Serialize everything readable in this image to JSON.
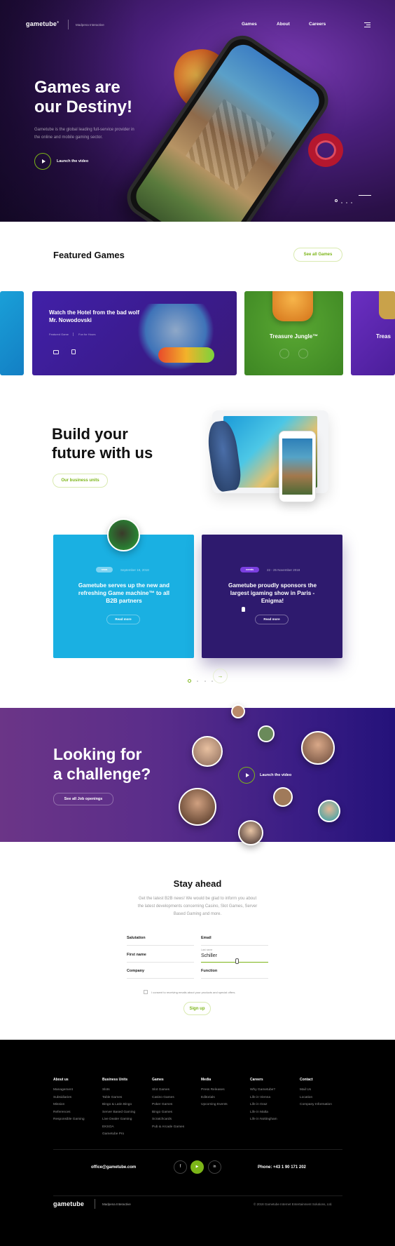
{
  "header": {
    "logo": "gametube",
    "logo_mark": "®",
    "logo_sub": "Madpena Interactive",
    "nav": [
      "Games",
      "About",
      "Careers"
    ],
    "menu_icon": "hamburger-icon"
  },
  "hero": {
    "title_line1": "Games are",
    "title_line2": "our Destiny!",
    "text": "Gametube is the global leading full-service provider in the online and mobile gaming sector.",
    "video_label": "Launch the video"
  },
  "featured": {
    "title": "Featured Games",
    "see_all": "See all Games",
    "card_main": {
      "title": "Watch the Hotel from the bad wolf Mr. Nowodovski",
      "meta1": "Featured Game",
      "meta2": "Fun for Hours"
    },
    "card_green": {
      "title": "Treasure Jungle™"
    },
    "card_purple": {
      "title": "Treas"
    }
  },
  "build": {
    "title_line1": "Build your",
    "title_line2": "future with us",
    "button": "Our business units"
  },
  "news": [
    {
      "tag": "news",
      "date": "September 18, 2018",
      "title": "Gametube serves up the new and refreshing Game machine™ to all B2B partners",
      "read": "Read more",
      "color": "#1ab0e2",
      "tag_color": "#7fd4f2"
    },
    {
      "tag": "events",
      "date": "22 - 25 November 2018",
      "title": "Gametube proudly sponsors the largest igaming show in Paris - Enigma!",
      "read": "Read more",
      "color": "#2e1a6e",
      "tag_color": "#7b3fe0"
    }
  ],
  "challenge": {
    "title_line1": "Looking for",
    "title_line2": "a challenge?",
    "button": "See all Job openings",
    "video_label": "Launch the video"
  },
  "newsletter": {
    "title": "Stay ahead",
    "text": "Get the latest B2B news! We would be glad to inform you about the latest developments concerning Casino, Slot Games, Server Based Gaming and more.",
    "fields": {
      "salutation": "Salutation",
      "email": "Email",
      "first_name": "First name",
      "last_name_label": "Last name",
      "last_name_value": "Schiller",
      "company": "Company",
      "function": "Function"
    },
    "consent": "I consent to receiving emails about your products and special offers.",
    "button": "Sign up"
  },
  "footer": {
    "columns": [
      {
        "head": "About us",
        "items": [
          "Management",
          "Subsidiaries",
          "Mission",
          "References",
          "Responsible Gaming"
        ]
      },
      {
        "head": "Business Units",
        "items": [
          "Slots",
          "Table Games",
          "Bingo & Latin Bingo",
          "Server Based Gaming",
          "Live Dealer Gaming",
          "EKSOA",
          "Gametube Pro"
        ]
      },
      {
        "head": "Games",
        "items": [
          "Slot Games",
          "Casino Games",
          "Poker Games",
          "Bingo Games",
          "Scratchcards",
          "Pub & Arcade Games"
        ]
      },
      {
        "head": "Media",
        "items": [
          "Press Releases",
          "Editorials",
          "Upcoming Events"
        ]
      },
      {
        "head": "Careers",
        "items": [
          "Why Gametube?",
          "Life in Vienna",
          "Life in Graz",
          "Life in Malta",
          "Life in Nottingham"
        ]
      },
      {
        "head": "Contact",
        "items": [
          "Mail Us",
          "Location",
          "Company Information"
        ]
      }
    ],
    "email": "office@gametube.com",
    "phone": "Phone: +43 1 90 171 202",
    "social": [
      "f",
      "▶",
      "in"
    ],
    "logo": "gametube",
    "logo_sub": "Madpena Interactive",
    "copyright": "© 2018 Gametube Internet Entertainment Solutions, Ltd."
  },
  "colors": {
    "accent": "#7cb518",
    "hero_purple": "#4a1f7c",
    "footer": "#000000"
  }
}
